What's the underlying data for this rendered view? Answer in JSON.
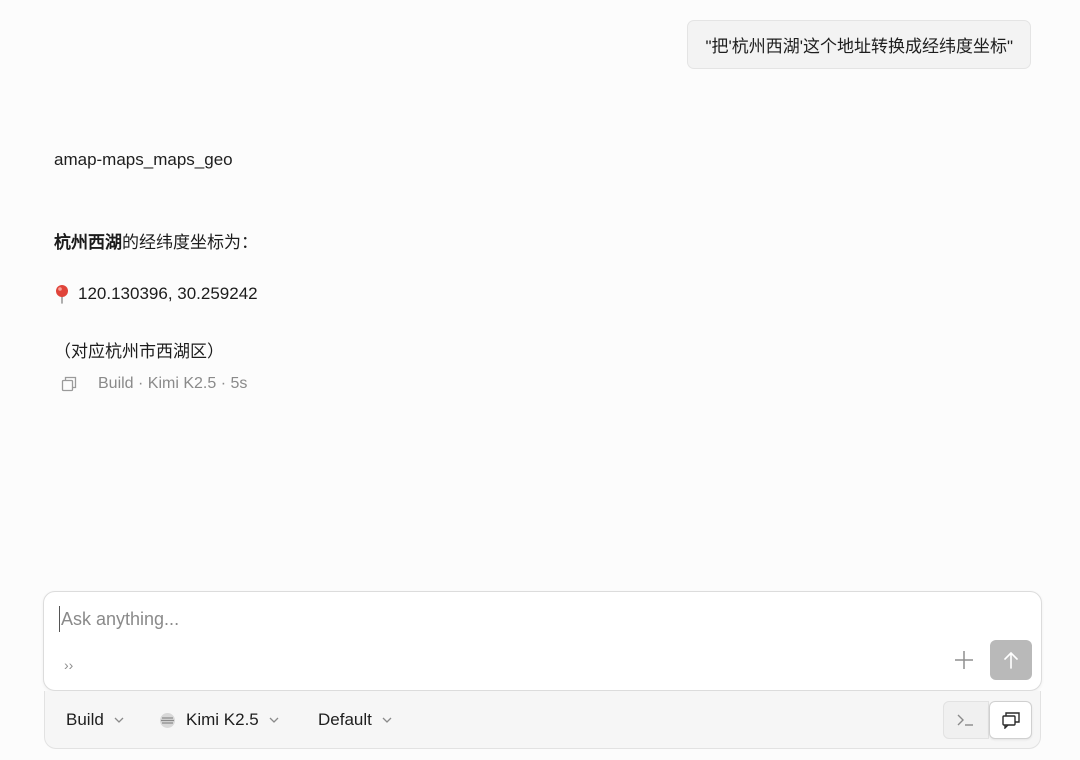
{
  "conversation": {
    "user_message": "\"把'杭州西湖'这个地址转换成经纬度坐标\"",
    "tool_call_name": "amap-maps_maps_geo",
    "answer": {
      "location_bold": "杭州西湖",
      "location_rest": "的经纬度坐标为：",
      "coordinates": "120.130396, 30.259242",
      "pin_icon": "round-pushpin-icon",
      "note": "（对应杭州市西湖区）"
    },
    "meta": {
      "text": "Build · Kimi K2.5 · 5s",
      "copy_icon": "copy-icon"
    }
  },
  "composer": {
    "placeholder": "Ask anything...",
    "value": "",
    "expand_icon_glyph": "››",
    "add_icon": "plus-icon",
    "send_icon": "arrow-up-icon"
  },
  "toolbar": {
    "agent": "Build",
    "model": "Kimi K2.5",
    "variant": "Default",
    "terminal_icon": "terminal-icon",
    "panel_icon": "chat-panel-icon"
  },
  "colors": {
    "background": "#fcfcfc",
    "bubble": "#f3f3f3",
    "send_button": "#b9b9b9",
    "muted_text": "#8a8a8a",
    "pin_red": "#e0443a"
  }
}
